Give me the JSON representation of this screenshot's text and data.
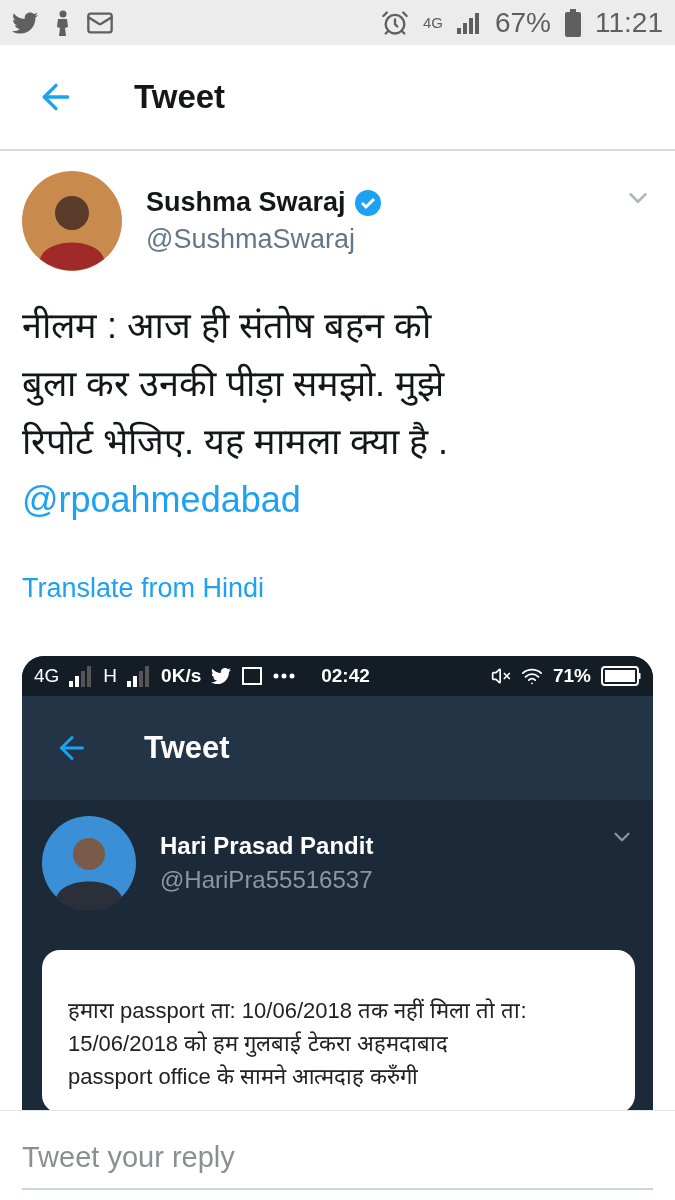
{
  "status_bar": {
    "signal_label": "4G",
    "battery": "67%",
    "time": "11:21"
  },
  "header": {
    "title": "Tweet"
  },
  "tweet": {
    "author": {
      "name": "Sushma Swaraj",
      "handle": "@SushmaSwaraj",
      "verified": true
    },
    "text_lines": [
      "नीलम : आज ही संतोष बहन को",
      "बुला कर उनकी पीड़ा  समझो. मुझे",
      "रिपोर्ट भेजिए. यह मामला क्या है ."
    ],
    "mention": "@rpoahmedabad",
    "translate_link": "Translate from Hindi",
    "attached_screenshot": {
      "status_bar": {
        "network_1": "4G",
        "network_2": "H",
        "speed": "0K/s",
        "time": "02:42",
        "battery": "71%"
      },
      "header": {
        "title": "Tweet"
      },
      "author": {
        "name": "Hari Prasad Pandit",
        "handle": "@HariPra55516537"
      },
      "card_lines": [
        "हमारा passport ता: 10/06/2018 तक नहीं मिला तो ता:",
        "15/06/2018 को हम  गुलबाई टेकरा अहमदाबाद",
        "passport office  के सामने आत्मदाह करुँगी"
      ]
    }
  },
  "reply": {
    "placeholder": "Tweet your reply"
  }
}
